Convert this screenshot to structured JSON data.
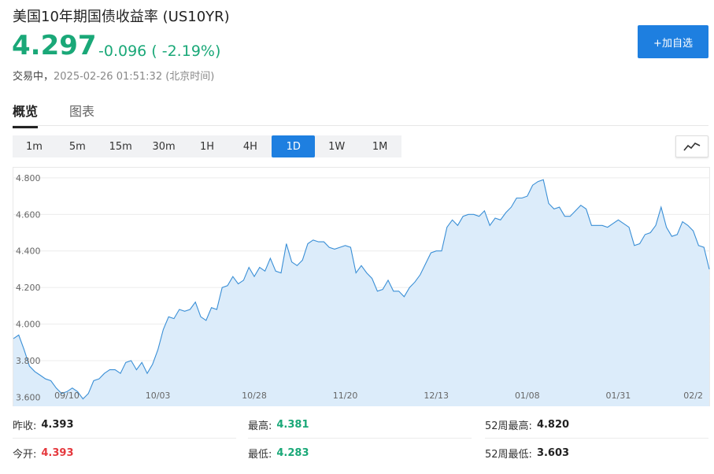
{
  "header": {
    "title": "美国10年期国债收益率  (US10YR)",
    "price": "4.297",
    "change": "-0.096 ( -2.19%)",
    "status_label": "交易中，",
    "timestamp": "2025-02-26 01:51:32 (北京时间)",
    "add_watchlist_label": "+加自选"
  },
  "tabs": [
    {
      "label": "概览",
      "active": true
    },
    {
      "label": "图表",
      "active": false
    }
  ],
  "ranges": [
    {
      "label": "1m",
      "active": false
    },
    {
      "label": "5m",
      "active": false
    },
    {
      "label": "15m",
      "active": false
    },
    {
      "label": "30m",
      "active": false
    },
    {
      "label": "1H",
      "active": false
    },
    {
      "label": "4H",
      "active": false
    },
    {
      "label": "1D",
      "active": true
    },
    {
      "label": "1W",
      "active": false
    },
    {
      "label": "1M",
      "active": false
    }
  ],
  "chart_type_icon": "line-chart-icon",
  "colors": {
    "accent": "#1e7fe0",
    "down": "#1aa878",
    "up": "#e5393e",
    "line": "#3a8fd6",
    "area": "#dcecfa"
  },
  "chart_data": {
    "type": "area",
    "ylim": [
      3.55,
      4.86
    ],
    "y_ticks": [
      "4.800",
      "4.600",
      "4.400",
      "4.200",
      "4.000",
      "3.800",
      "3.600"
    ],
    "y_tick_values": [
      4.8,
      4.6,
      4.4,
      4.2,
      4.0,
      3.8,
      3.6
    ],
    "x_labels": [
      {
        "label": "09/10",
        "index": 10
      },
      {
        "label": "10/03",
        "index": 27
      },
      {
        "label": "10/28",
        "index": 45
      },
      {
        "label": "11/20",
        "index": 62
      },
      {
        "label": "12/13",
        "index": 79
      },
      {
        "label": "01/08",
        "index": 96
      },
      {
        "label": "01/31",
        "index": 113
      },
      {
        "label": "02/2",
        "index": 127
      }
    ],
    "values": [
      3.92,
      3.94,
      3.86,
      3.77,
      3.74,
      3.72,
      3.7,
      3.69,
      3.65,
      3.62,
      3.63,
      3.65,
      3.63,
      3.59,
      3.62,
      3.69,
      3.7,
      3.73,
      3.75,
      3.75,
      3.73,
      3.79,
      3.8,
      3.75,
      3.79,
      3.73,
      3.78,
      3.86,
      3.97,
      4.04,
      4.03,
      4.08,
      4.07,
      4.08,
      4.12,
      4.04,
      4.02,
      4.09,
      4.08,
      4.2,
      4.21,
      4.26,
      4.22,
      4.24,
      4.31,
      4.26,
      4.31,
      4.29,
      4.36,
      4.29,
      4.28,
      4.44,
      4.34,
      4.32,
      4.35,
      4.44,
      4.46,
      4.45,
      4.45,
      4.42,
      4.41,
      4.42,
      4.43,
      4.42,
      4.28,
      4.32,
      4.28,
      4.25,
      4.18,
      4.19,
      4.24,
      4.18,
      4.18,
      4.15,
      4.2,
      4.23,
      4.27,
      4.33,
      4.39,
      4.4,
      4.4,
      4.53,
      4.57,
      4.54,
      4.59,
      4.6,
      4.6,
      4.59,
      4.62,
      4.54,
      4.58,
      4.57,
      4.61,
      4.64,
      4.69,
      4.69,
      4.7,
      4.76,
      4.78,
      4.79,
      4.66,
      4.63,
      4.64,
      4.59,
      4.59,
      4.62,
      4.65,
      4.63,
      4.54,
      4.54,
      4.54,
      4.53,
      4.55,
      4.57,
      4.55,
      4.53,
      4.43,
      4.44,
      4.49,
      4.5,
      4.54,
      4.64,
      4.53,
      4.48,
      4.49,
      4.56,
      4.54,
      4.51,
      4.43,
      4.42,
      4.3
    ]
  },
  "stats": {
    "prev_close_label": "昨收:",
    "prev_close": "4.393",
    "high_label": "最高:",
    "high": "4.381",
    "week52_high_label": "52周最高:",
    "week52_high": "4.820",
    "open_label": "今开:",
    "open": "4.393",
    "low_label": "最低:",
    "low": "4.283",
    "week52_low_label": "52周最低:",
    "week52_low": "3.603"
  }
}
